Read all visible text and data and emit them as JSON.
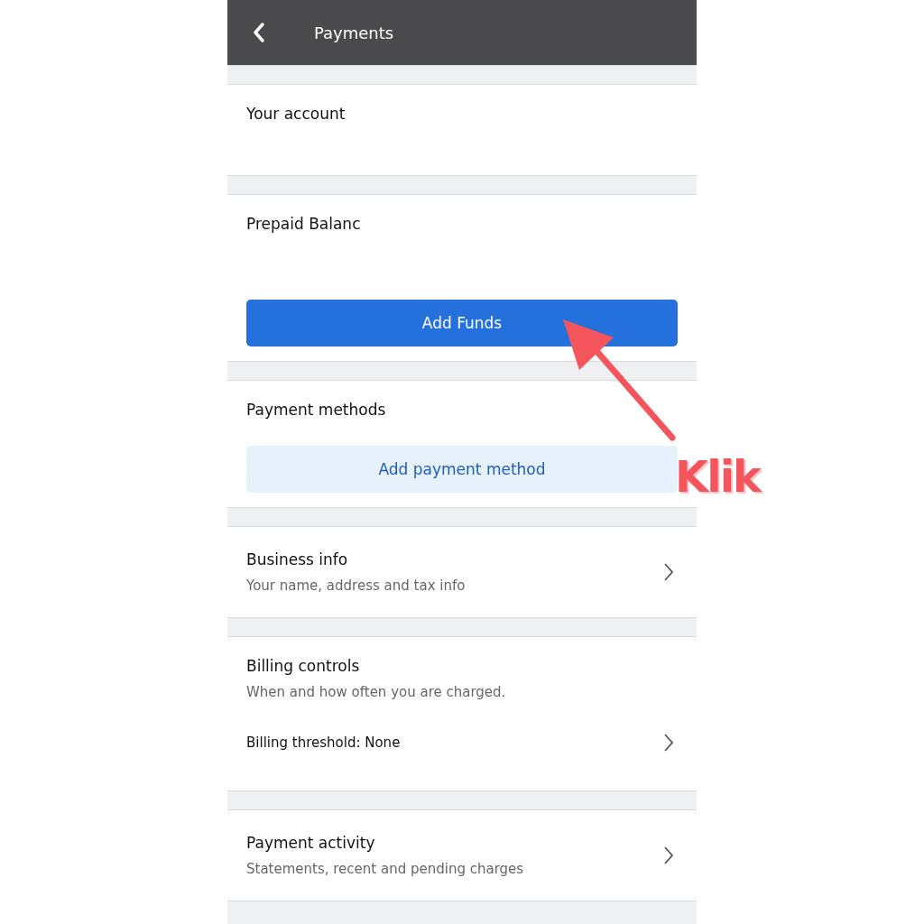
{
  "header": {
    "title": "Payments"
  },
  "sections": [
    {
      "kind": "plain",
      "title": "Your account"
    },
    {
      "kind": "button",
      "title": "Prepaid Balanc",
      "button": "Add Funds",
      "primary": true
    },
    {
      "kind": "button",
      "title": "Payment methods",
      "button": "Add payment method",
      "primary": false
    },
    {
      "kind": "link",
      "title": "Business info",
      "subtitle": "Your name, address and tax info"
    },
    {
      "kind": "billing",
      "title": "Billing controls",
      "subtitle": "When and how often you are charged.",
      "row": "Billing threshold: None"
    },
    {
      "kind": "link",
      "title": "Payment activity",
      "subtitle": "Statements, recent and pending charges"
    }
  ],
  "annotation": {
    "label": "Klik"
  }
}
